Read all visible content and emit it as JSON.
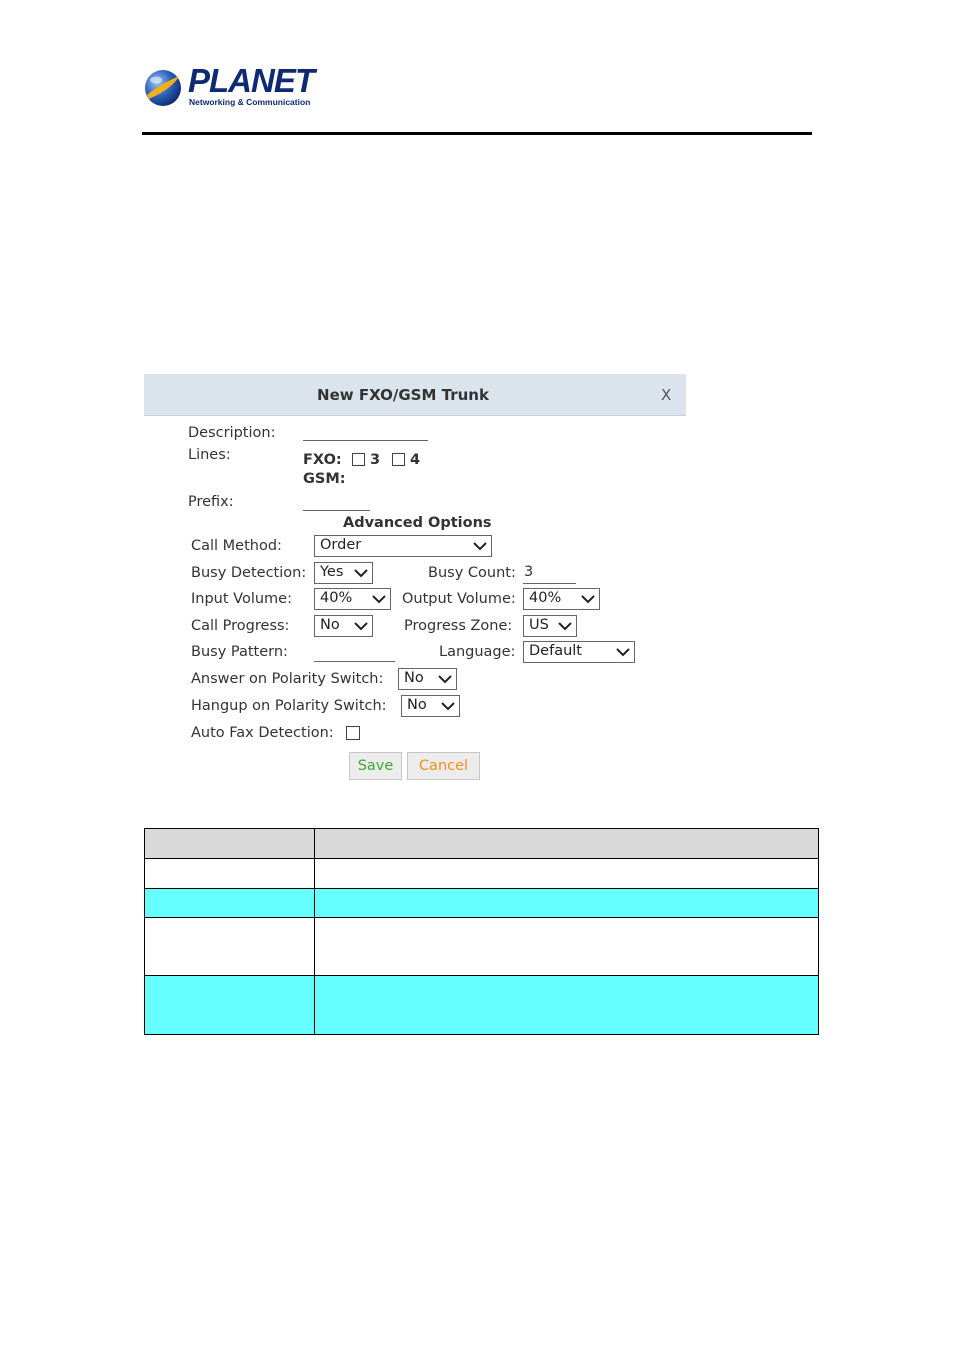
{
  "brand": {
    "name": "PLANET",
    "tagline": "Networking & Communication",
    "colors": {
      "navy": "#0d2a73",
      "globe_blue": "#2c62b8",
      "globe_gold": "#f2b01e"
    }
  },
  "dialog": {
    "title": "New FXO/GSM Trunk",
    "close_label": "X",
    "fields": {
      "description_label": "Description:",
      "description_value": "",
      "lines_label": "Lines:",
      "fxo_label": "FXO:",
      "fxo_line_3": "3",
      "fxo_line_4": "4",
      "gsm_label": "GSM:",
      "prefix_label": "Prefix:",
      "prefix_value": ""
    },
    "advanced": {
      "heading": "Advanced Options",
      "call_method_label": "Call Method:",
      "call_method_value": "Order",
      "busy_detection_label": "Busy Detection:",
      "busy_detection_value": "Yes",
      "busy_count_label": "Busy Count:",
      "busy_count_value": "3",
      "input_volume_label": "Input Volume:",
      "input_volume_value": "40%",
      "output_volume_label": "Output Volume:",
      "output_volume_value": "40%",
      "call_progress_label": "Call Progress:",
      "call_progress_value": "No",
      "progress_zone_label": "Progress Zone:",
      "progress_zone_value": "US",
      "busy_pattern_label": "Busy Pattern:",
      "busy_pattern_value": "",
      "language_label": "Language:",
      "language_value": "Default",
      "answer_polarity_label": "Answer on Polarity Switch:",
      "answer_polarity_value": "No",
      "hangup_polarity_label": "Hangup on Polarity Switch:",
      "hangup_polarity_value": "No",
      "auto_fax_label": "Auto Fax Detection:"
    },
    "buttons": {
      "save": "Save",
      "cancel": "Cancel"
    }
  },
  "table": {
    "colors": {
      "header": "#d9d9d9",
      "highlight": "#66ffff",
      "plain": "#ffffff"
    },
    "rows": [
      {
        "c1": "",
        "c2": ""
      },
      {
        "c1": "",
        "c2": ""
      },
      {
        "c1": "",
        "c2": ""
      },
      {
        "c1": "",
        "c2": ""
      },
      {
        "c1": "",
        "c2": ""
      }
    ]
  }
}
